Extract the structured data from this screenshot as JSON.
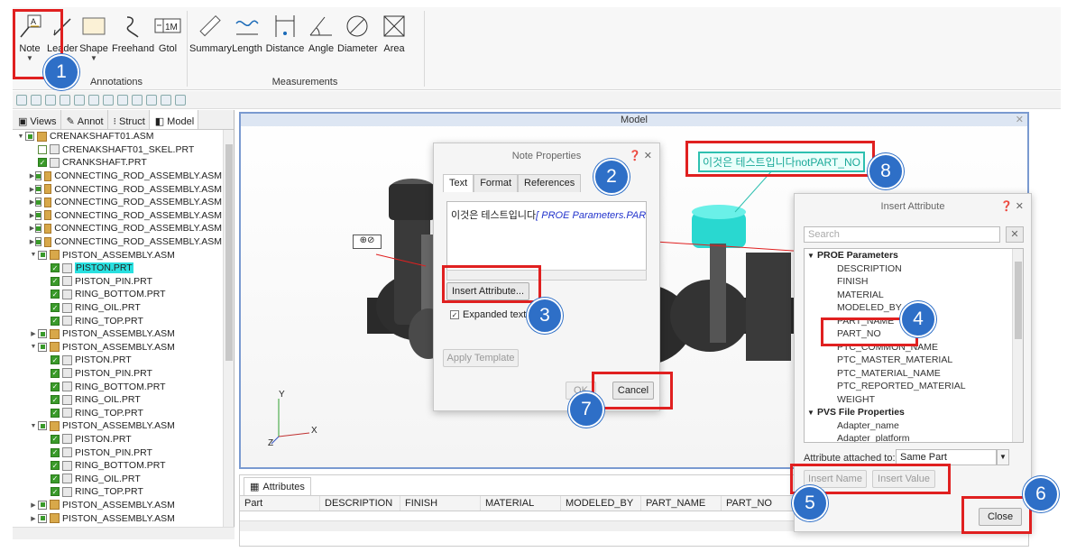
{
  "ribbon": {
    "annotations_group": "Annotations",
    "measurements_group": "Measurements",
    "annotation_buttons": [
      "Note",
      "Leader",
      "Shape",
      "Freehand",
      "Gtol"
    ],
    "measurement_buttons": [
      "Summary",
      "Length",
      "Distance",
      "Angle",
      "Diameter",
      "Area"
    ]
  },
  "left_panel": {
    "tabs": [
      "Views",
      "Annot",
      "Struct",
      "Model"
    ],
    "tree": [
      {
        "label": "CRENAKSHAFT01.ASM",
        "level": 0,
        "type": "asm",
        "exp": "open"
      },
      {
        "label": "CRENAKSHAFT01_SKEL.PRT",
        "level": 1,
        "type": "prt-off"
      },
      {
        "label": "CRANKSHAFT.PRT",
        "level": 1,
        "type": "prt"
      },
      {
        "label": "CONNECTING_ROD_ASSEMBLY.ASM",
        "level": 1,
        "type": "asm",
        "exp": "closed"
      },
      {
        "label": "CONNECTING_ROD_ASSEMBLY.ASM",
        "level": 1,
        "type": "asm",
        "exp": "closed"
      },
      {
        "label": "CONNECTING_ROD_ASSEMBLY.ASM",
        "level": 1,
        "type": "asm",
        "exp": "closed"
      },
      {
        "label": "CONNECTING_ROD_ASSEMBLY.ASM",
        "level": 1,
        "type": "asm",
        "exp": "closed"
      },
      {
        "label": "CONNECTING_ROD_ASSEMBLY.ASM",
        "level": 1,
        "type": "asm",
        "exp": "closed"
      },
      {
        "label": "CONNECTING_ROD_ASSEMBLY.ASM",
        "level": 1,
        "type": "asm",
        "exp": "closed"
      },
      {
        "label": "PISTON_ASSEMBLY.ASM",
        "level": 1,
        "type": "asm",
        "exp": "open"
      },
      {
        "label": "PISTON.PRT",
        "level": 2,
        "type": "prt",
        "selected": true
      },
      {
        "label": "PISTON_PIN.PRT",
        "level": 2,
        "type": "prt"
      },
      {
        "label": "RING_BOTTOM.PRT",
        "level": 2,
        "type": "prt"
      },
      {
        "label": "RING_OIL.PRT",
        "level": 2,
        "type": "prt"
      },
      {
        "label": "RING_TOP.PRT",
        "level": 2,
        "type": "prt"
      },
      {
        "label": "PISTON_ASSEMBLY.ASM",
        "level": 1,
        "type": "asm",
        "exp": "closed"
      },
      {
        "label": "PISTON_ASSEMBLY.ASM",
        "level": 1,
        "type": "asm",
        "exp": "open"
      },
      {
        "label": "PISTON.PRT",
        "level": 2,
        "type": "prt"
      },
      {
        "label": "PISTON_PIN.PRT",
        "level": 2,
        "type": "prt"
      },
      {
        "label": "RING_BOTTOM.PRT",
        "level": 2,
        "type": "prt"
      },
      {
        "label": "RING_OIL.PRT",
        "level": 2,
        "type": "prt"
      },
      {
        "label": "RING_TOP.PRT",
        "level": 2,
        "type": "prt"
      },
      {
        "label": "PISTON_ASSEMBLY.ASM",
        "level": 1,
        "type": "asm",
        "exp": "open"
      },
      {
        "label": "PISTON.PRT",
        "level": 2,
        "type": "prt"
      },
      {
        "label": "PISTON_PIN.PRT",
        "level": 2,
        "type": "prt"
      },
      {
        "label": "RING_BOTTOM.PRT",
        "level": 2,
        "type": "prt"
      },
      {
        "label": "RING_OIL.PRT",
        "level": 2,
        "type": "prt"
      },
      {
        "label": "RING_TOP.PRT",
        "level": 2,
        "type": "prt"
      },
      {
        "label": "PISTON_ASSEMBLY.ASM",
        "level": 1,
        "type": "asm",
        "exp": "closed"
      },
      {
        "label": "PISTON_ASSEMBLY.ASM",
        "level": 1,
        "type": "asm",
        "exp": "closed"
      }
    ]
  },
  "model": {
    "title": "Model",
    "axis_y": "Y",
    "axis_x": "X",
    "axis_z": "Z",
    "callout_note": "이것은 테스트입니다notPART_NO"
  },
  "note_properties": {
    "title": "Note Properties",
    "tabs": [
      "Text",
      "Format",
      "References"
    ],
    "text_value": "이것은 테스트입니다",
    "param_value": "[ PROE Parameters.PART_N",
    "insert_attribute": "Insert Attribute...",
    "expanded_text": "Expanded text",
    "apply_template": "Apply Template",
    "ok": "OK",
    "cancel": "Cancel"
  },
  "insert_attribute": {
    "title": "Insert Attribute",
    "search_placeholder": "Search",
    "groups": [
      {
        "name": "PROE Parameters",
        "items": [
          "DESCRIPTION",
          "FINISH",
          "MATERIAL",
          "MODELED_BY",
          "PART_NAME",
          "PART_NO",
          "PTC_COMMON_NAME",
          "PTC_MASTER_MATERIAL",
          "PTC_MATERIAL_NAME",
          "PTC_REPORTED_MATERIAL",
          "WEIGHT"
        ]
      },
      {
        "name": "PVS File Properties",
        "items": [
          "Adapter_name",
          "Adapter_platform"
        ]
      }
    ],
    "attached_label": "Attribute attached to:",
    "attached_value": "Same Part",
    "insert_name": "Insert Name",
    "insert_value": "Insert Value",
    "close": "Close"
  },
  "attributes_panel": {
    "tab": "Attributes",
    "columns": [
      "Part",
      "DESCRIPTION",
      "FINISH",
      "MATERIAL",
      "MODELED_BY",
      "PART_NAME",
      "PART_NO"
    ]
  },
  "callouts": [
    "1",
    "2",
    "3",
    "4",
    "5",
    "6",
    "7",
    "8"
  ],
  "colors": {
    "highlight_red": "#e02020",
    "callout_blue": "#2e6fc7",
    "selection_cyan": "#29e0e0",
    "note_teal": "#2ec0b0"
  }
}
